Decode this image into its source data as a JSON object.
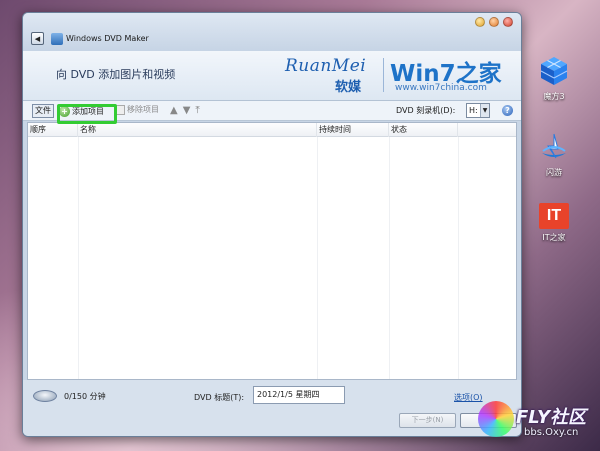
{
  "window": {
    "title": "Windows DVD Maker",
    "page_title": "向 DVD 添加图片和视频"
  },
  "brand": {
    "ruanmei": "RuanMei",
    "ruanmei_cn": "软媒",
    "win7": "Win7之家",
    "url": "www.win7china.com"
  },
  "toolbar": {
    "file_label": "文件",
    "add_label": "添加项目",
    "remove_label": "移除项目",
    "drive_label": "DVD 刻录机(D):",
    "drive_value": "H:",
    "help_symbol": "?"
  },
  "list": {
    "columns": [
      "顺序",
      "名称",
      "持续时间",
      "状态"
    ]
  },
  "footer": {
    "duration": "0/150 分钟",
    "title_label": "DVD 标题(T):",
    "title_value": "2012/1/5 星期四",
    "options_label": "选项(O)",
    "next_label": "下一步(N)"
  },
  "desktop": {
    "icons": [
      {
        "label": "魔方3",
        "icon": "cube-icon"
      },
      {
        "label": "闪游",
        "icon": "flash-browser-icon"
      },
      {
        "label": "IT之家",
        "icon": "it-home-icon",
        "glyph": "IT"
      }
    ]
  },
  "watermark": {
    "name": "FLY社区",
    "url": "bbs.Oxy.cn"
  },
  "colors": {
    "highlight": "#33cc33",
    "link": "#1a52a8",
    "brand_blue": "#1e73c8"
  }
}
